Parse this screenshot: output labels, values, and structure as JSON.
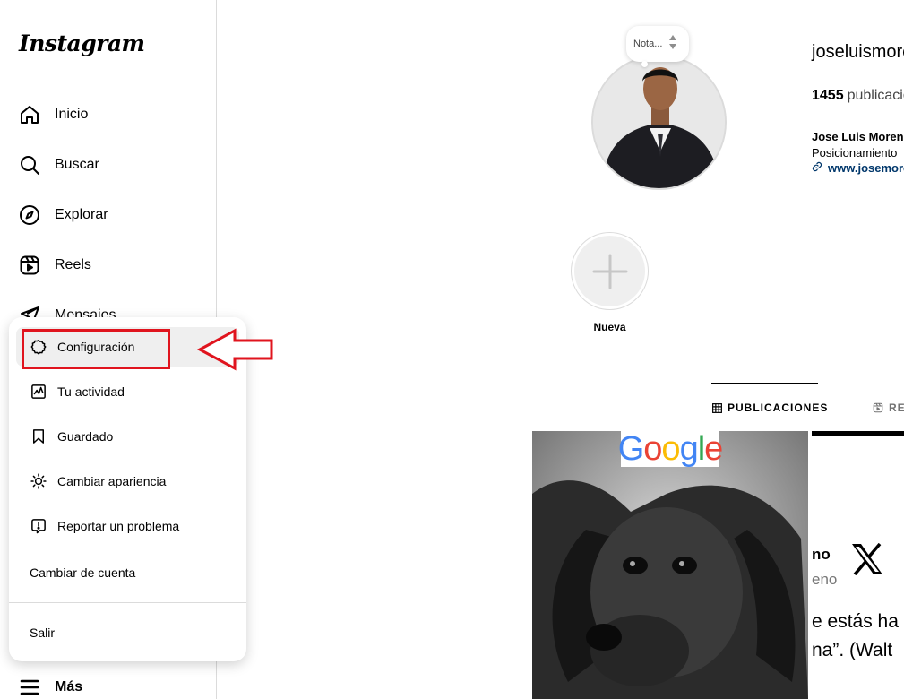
{
  "app": {
    "logo": "Instagram"
  },
  "sidebar": {
    "items": [
      {
        "label": "Inicio",
        "icon": "home-icon"
      },
      {
        "label": "Buscar",
        "icon": "search-icon"
      },
      {
        "label": "Explorar",
        "icon": "compass-icon"
      },
      {
        "label": "Reels",
        "icon": "reels-icon"
      },
      {
        "label": "Mensajes",
        "icon": "messages-icon"
      }
    ],
    "more_label": "Más"
  },
  "menu": {
    "items": [
      {
        "label": "Configuración",
        "icon": "gear-icon"
      },
      {
        "label": "Tu actividad",
        "icon": "activity-icon"
      },
      {
        "label": "Guardado",
        "icon": "bookmark-icon"
      },
      {
        "label": "Cambiar apariencia",
        "icon": "sun-icon"
      },
      {
        "label": "Reportar un problema",
        "icon": "report-icon"
      }
    ],
    "switch_account": "Cambiar de cuenta",
    "logout": "Salir"
  },
  "annotation": {
    "color": "#e0141e"
  },
  "profile": {
    "note_placeholder": "Nota...",
    "username": "joseluismoreno",
    "posts_count": "1455",
    "posts_label": "publicaciones",
    "full_name": "Jose Luis Moreno",
    "bio": "Posicionamiento",
    "link": "www.josemoreno",
    "new_highlight": "Nueva"
  },
  "tabs": [
    {
      "label": "PUBLICACIONES",
      "icon": "grid-icon",
      "active": true
    },
    {
      "label": "REELS",
      "icon": "reels-icon",
      "active": false
    }
  ],
  "posts": {
    "post1_badge": "Google",
    "post2": {
      "name": "no",
      "handle": "eno",
      "quote_line1": "e estás ha",
      "quote_line2": "na”. (Walt"
    }
  },
  "colors": {
    "accent": "#0095f6",
    "link": "#00376b",
    "border": "#dbdbdb",
    "annotation_red": "#e0141e"
  }
}
